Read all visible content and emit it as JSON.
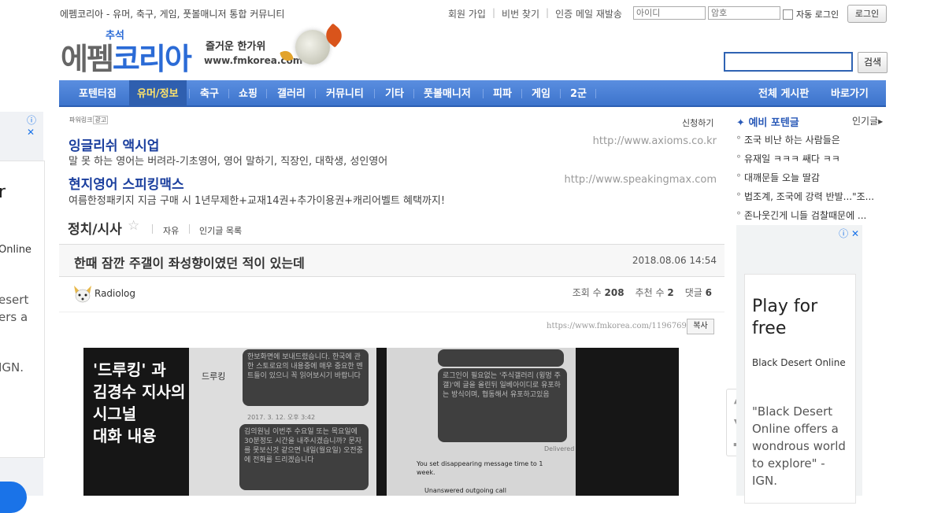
{
  "topbar": {
    "site_name": "에펨코리아 - 유머, 축구, 게임, 풋볼매니저 통합 커뮤니티",
    "links": [
      "회원 가입",
      "비번 찾기",
      "인증 메일 재발송"
    ],
    "id_placeholder": "아이디",
    "pw_placeholder": "암호",
    "auto_login": "자동 로그인",
    "login_button": "로그인"
  },
  "logo": {
    "small": "추석",
    "main_a": "에펨",
    "main_b": "코리아",
    "tagline": "즐거운 한가위",
    "url": "www.fmkorea.com"
  },
  "search": {
    "button": "검색"
  },
  "nav": {
    "items": [
      "포텐터짐",
      "유머/정보",
      "축구",
      "쇼핑",
      "갤러리",
      "커뮤니티",
      "기타",
      "풋볼매니저",
      "피파",
      "게임",
      "2군"
    ],
    "right": [
      "전체 게시판",
      "바로가기"
    ]
  },
  "powerlink": {
    "label": "파워링크",
    "badge": "광고",
    "apply": "신청하기",
    "ads": [
      {
        "title": "잉글리쉬 액시업",
        "desc": "말 못 하는 영어는 버려라-기초영어, 영어 말하기, 직장인, 대학생, 성인영어",
        "url": "http://www.axioms.co.kr"
      },
      {
        "title": "현지영어 스피킹맥스",
        "desc": "여름한정패키지 지금 구매 시 1년무제한+교재14권+추가이용권+캐리어벨트 혜택까지!",
        "url": "http://www.speakingmax.com"
      }
    ]
  },
  "board": {
    "title": "정치/시사",
    "links": [
      "자유",
      "인기글 목록"
    ]
  },
  "post": {
    "title": "한때 잠깐 주갤이 좌성향이였던 적이 있는데",
    "date": "2018.08.06 14:54",
    "author": "Radiolog",
    "views_label": "조회 수",
    "views": "208",
    "likes_label": "추천 수",
    "likes": "2",
    "comments_label": "댓글",
    "comments": "6",
    "url": "https://www.fmkorea.com/1196769696",
    "copy": "복사"
  },
  "image": {
    "caption": [
      "'드루킹' 과",
      "김경수 지사의",
      "시그널",
      "대화 내용"
    ],
    "chat_name": "드루킹",
    "chat_date": "2017. 3. 12. 오후 3:42",
    "bubble1": "한보화면에 보내드렸습니다. 한국에 관한 스토로요의 내용중에 매우 중요한 멘트들이 있으니 꼭 읽어보시기 바랍니다",
    "bubble2": "김의원님 이번주 수요일 또는 목요일에 30분정도 시간을 내주시겠습니까? 문자를 못보신것 같으면 내일(월요일) 오전중에 전화를 드리겠습니다",
    "bubble3": "로그인이 필요없는 '주식갤러리 (윙멍 주갤)'에 글을 올린뒤 일베아이디로 유포하는 방식이며, 협동해서 유포하고있음",
    "delivered": "Delivered",
    "sys1": "You set disappearing message time to 1 week.",
    "sys2": "Unanswered outgoing call"
  },
  "float_tools": [
    "up-arrow-icon",
    "down-arrow-icon",
    "comment-icon"
  ],
  "ranking": {
    "title": "예비 포텐글",
    "more": "인기글",
    "items": [
      "조국 비난 하는 사람들은",
      "유재일 ㅋㅋㅋ 쌔다 ㅋㅋ",
      "대깨문들 오늘 딸감",
      "법조계, 조국에 강력 반발...\"조...",
      "존나웃긴게 니들 검찰때문에 ..."
    ]
  },
  "right_ad": {
    "headline": "Play for free",
    "name": "Black Desert Online",
    "quote": "\"Black Desert Online offers a wondrous world to explore\" - IGN."
  },
  "left_ad": {
    "headline": "r",
    "name": "Online",
    "quote": "esert ers a",
    "source": "IGN."
  }
}
